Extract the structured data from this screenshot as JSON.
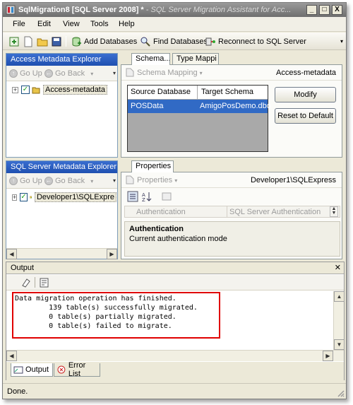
{
  "window": {
    "title_main": "SqlMigration8 [SQL Server 2008] *",
    "title_rest": " - SQL Server Migration Assistant for Acc...",
    "minimize_glyph": "_",
    "maximize_glyph": "□",
    "close_glyph": "X"
  },
  "menu": {
    "items": [
      "File",
      "Edit",
      "View",
      "Tools",
      "Help"
    ]
  },
  "toolbar": {
    "add_databases": "Add Databases",
    "find_databases": "Find Databases",
    "reconnect": "Reconnect to SQL Server"
  },
  "access_explorer": {
    "title": "Access Metadata Explorer",
    "go_up": "Go Up",
    "go_back": "Go Back",
    "tree_root": "Access-metadata"
  },
  "schema_panel": {
    "tabs": [
      "Schema...",
      "Type Mappi"
    ],
    "dropdown_label": "Schema Mapping",
    "context": "Access-metadata",
    "columns": [
      "Source Database",
      "Target Schema"
    ],
    "rows": [
      {
        "source": "POSData",
        "target": "AmigoPosDemo.dbo"
      }
    ],
    "modify": "Modify",
    "reset": "Reset to Default"
  },
  "sql_explorer": {
    "title": "SQL Server Metadata Explorer",
    "go_up": "Go Up",
    "go_back": "Go Back",
    "tree_root": "Developer1\\SQLExpre"
  },
  "properties_panel": {
    "tab": "Properties",
    "dropdown_label": "Properties",
    "context": "Developer1\\SQLExpress",
    "prop_name": "Authentication",
    "prop_value": "SQL Server Authentication",
    "desc_title": "Authentication",
    "desc_text": "Current authentication mode"
  },
  "output": {
    "title": "Output",
    "lines": [
      "Data migration operation has finished.",
      "        139 table(s) successfully migrated.",
      "        0 table(s) partially migrated.",
      "        0 table(s) failed to migrate."
    ],
    "tabs": [
      "Output",
      "Error List"
    ],
    "highlight_color": "#e00000"
  },
  "status": {
    "text": "Done."
  },
  "colors": {
    "accent": "#316ac5",
    "panel_header": "#2a5cc0"
  }
}
